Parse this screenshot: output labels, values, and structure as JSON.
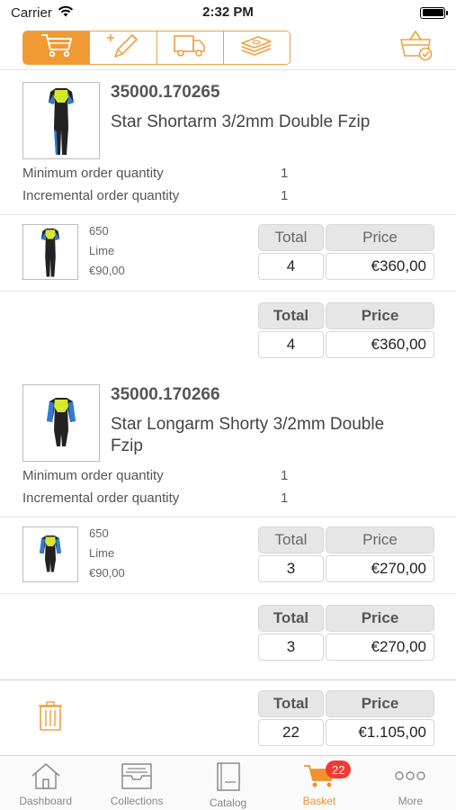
{
  "status_bar": {
    "carrier": "Carrier",
    "time": "2:32 PM"
  },
  "toolbar": {
    "tabs": [
      {
        "icon": "cart-icon",
        "active": true
      },
      {
        "icon": "add-edit-icon",
        "active": false
      },
      {
        "icon": "delivery-truck-icon",
        "active": false
      },
      {
        "icon": "money-stack-icon",
        "active": false
      }
    ],
    "right_icon": "basket-check-icon"
  },
  "colors": {
    "accent": "#f19a33",
    "badge": "#f23a33"
  },
  "products": [
    {
      "sku": "35000.170265",
      "name": "Star Shortarm 3/2mm Double Fzip",
      "min_order_label": "Minimum order quantity",
      "min_order_value": "1",
      "incr_order_label": "Incremental order quantity",
      "incr_order_value": "1",
      "variant": {
        "size": "650",
        "color": "Lime",
        "price": "€90,00",
        "total_label": "Total",
        "price_label": "Price",
        "qty": "4",
        "amount": "€360,00"
      },
      "summary": {
        "total_label": "Total",
        "price_label": "Price",
        "qty": "4",
        "amount": "€360,00"
      }
    },
    {
      "sku": "35000.170266",
      "name": "Star Longarm Shorty 3/2mm Double Fzip",
      "min_order_label": "Minimum order quantity",
      "min_order_value": "1",
      "incr_order_label": "Incremental order quantity",
      "incr_order_value": "1",
      "variant": {
        "size": "650",
        "color": "Lime",
        "price": "€90,00",
        "total_label": "Total",
        "price_label": "Price",
        "qty": "3",
        "amount": "€270,00"
      },
      "summary": {
        "total_label": "Total",
        "price_label": "Price",
        "qty": "3",
        "amount": "€270,00"
      }
    }
  ],
  "grand_total": {
    "total_label": "Total",
    "price_label": "Price",
    "qty": "22",
    "amount": "€1.105,00"
  },
  "tabbar": {
    "items": [
      {
        "label": "Dashboard",
        "icon": "home-icon"
      },
      {
        "label": "Collections",
        "icon": "collections-tray-icon"
      },
      {
        "label": "Catalog",
        "icon": "catalog-book-icon"
      },
      {
        "label": "Basket",
        "icon": "basket-cart-icon",
        "active": true,
        "badge": "22"
      },
      {
        "label": "More",
        "icon": "more-dots-icon"
      }
    ]
  }
}
